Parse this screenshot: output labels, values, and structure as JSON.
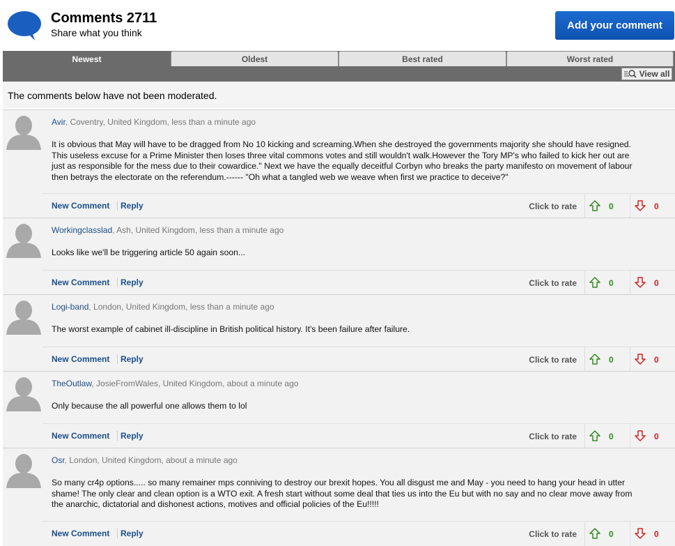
{
  "header": {
    "title": "Comments 2711",
    "subtitle": "Share what you think",
    "add_button": "Add your comment"
  },
  "tabs": [
    "Newest",
    "Oldest",
    "Best rated",
    "Worst rated"
  ],
  "active_tab": "Newest",
  "view_all": "View all",
  "notice": "The comments below have not been moderated.",
  "labels": {
    "new_comment": "New Comment",
    "reply": "Reply",
    "click_to_rate": "Click to rate"
  },
  "colors": {
    "accent": "#1b4f88",
    "button": "#0d52b0",
    "upvote": "#2f8a1e",
    "downvote": "#d62020"
  },
  "comments": [
    {
      "author": "Avir",
      "location": ", Coventry, United Kingdom, less than a minute ago",
      "lines": [
        "It is obvious that May will have to be dragged from No 10 kicking and screaming.When she destroyed the governments majority she should have resigned.",
        "This useless excuse for a Prime Minister then loses three vital commons votes and still wouldn't walk.However the Tory MP's who failed to kick her out are",
        "just as responsible for the mess due to their cowardice.\" Next we have the equally deceitful Corbyn who breaks the party manifesto on movement of labour",
        "then betrays the electorate on the referendum.------ \"Oh what a tangled web we weave when first we practice to deceive?\""
      ],
      "up": "0",
      "down": "0"
    },
    {
      "author": "Workingclasslad",
      "location": ", Ash, United Kingdom, less than a minute ago",
      "lines": [
        "Looks like we'll be triggering article 50 again soon..."
      ],
      "up": "0",
      "down": "0"
    },
    {
      "author": "Logi-band",
      "location": ", London, United Kingdom, less than a minute ago",
      "lines": [
        "The worst example of cabinet ill-discipline in British political history. It's been failure after failure."
      ],
      "up": "0",
      "down": "0"
    },
    {
      "author": "TheOutlaw",
      "location": ", JosieFromWales, United Kingdom, about a minute ago",
      "lines": [
        "Only because the all powerful one allows them to lol"
      ],
      "up": "0",
      "down": "0"
    },
    {
      "author": "Osr",
      "location": ", London, United Kingdom, about a minute ago",
      "lines": [
        "So many cr4p options..... so many remainer mps conniving to destroy our brexit hopes. You all disgust me and May - you need to hang your head in utter",
        "shame! The only clear and clean option is a WTO exit. A fresh start without some deal that ties us into the Eu but with no say and no clear move away from",
        "the anarchic, dictatorial and dishonest actions, motives and official policies of the Eu!!!!!"
      ],
      "up": "0",
      "down": "0"
    }
  ]
}
